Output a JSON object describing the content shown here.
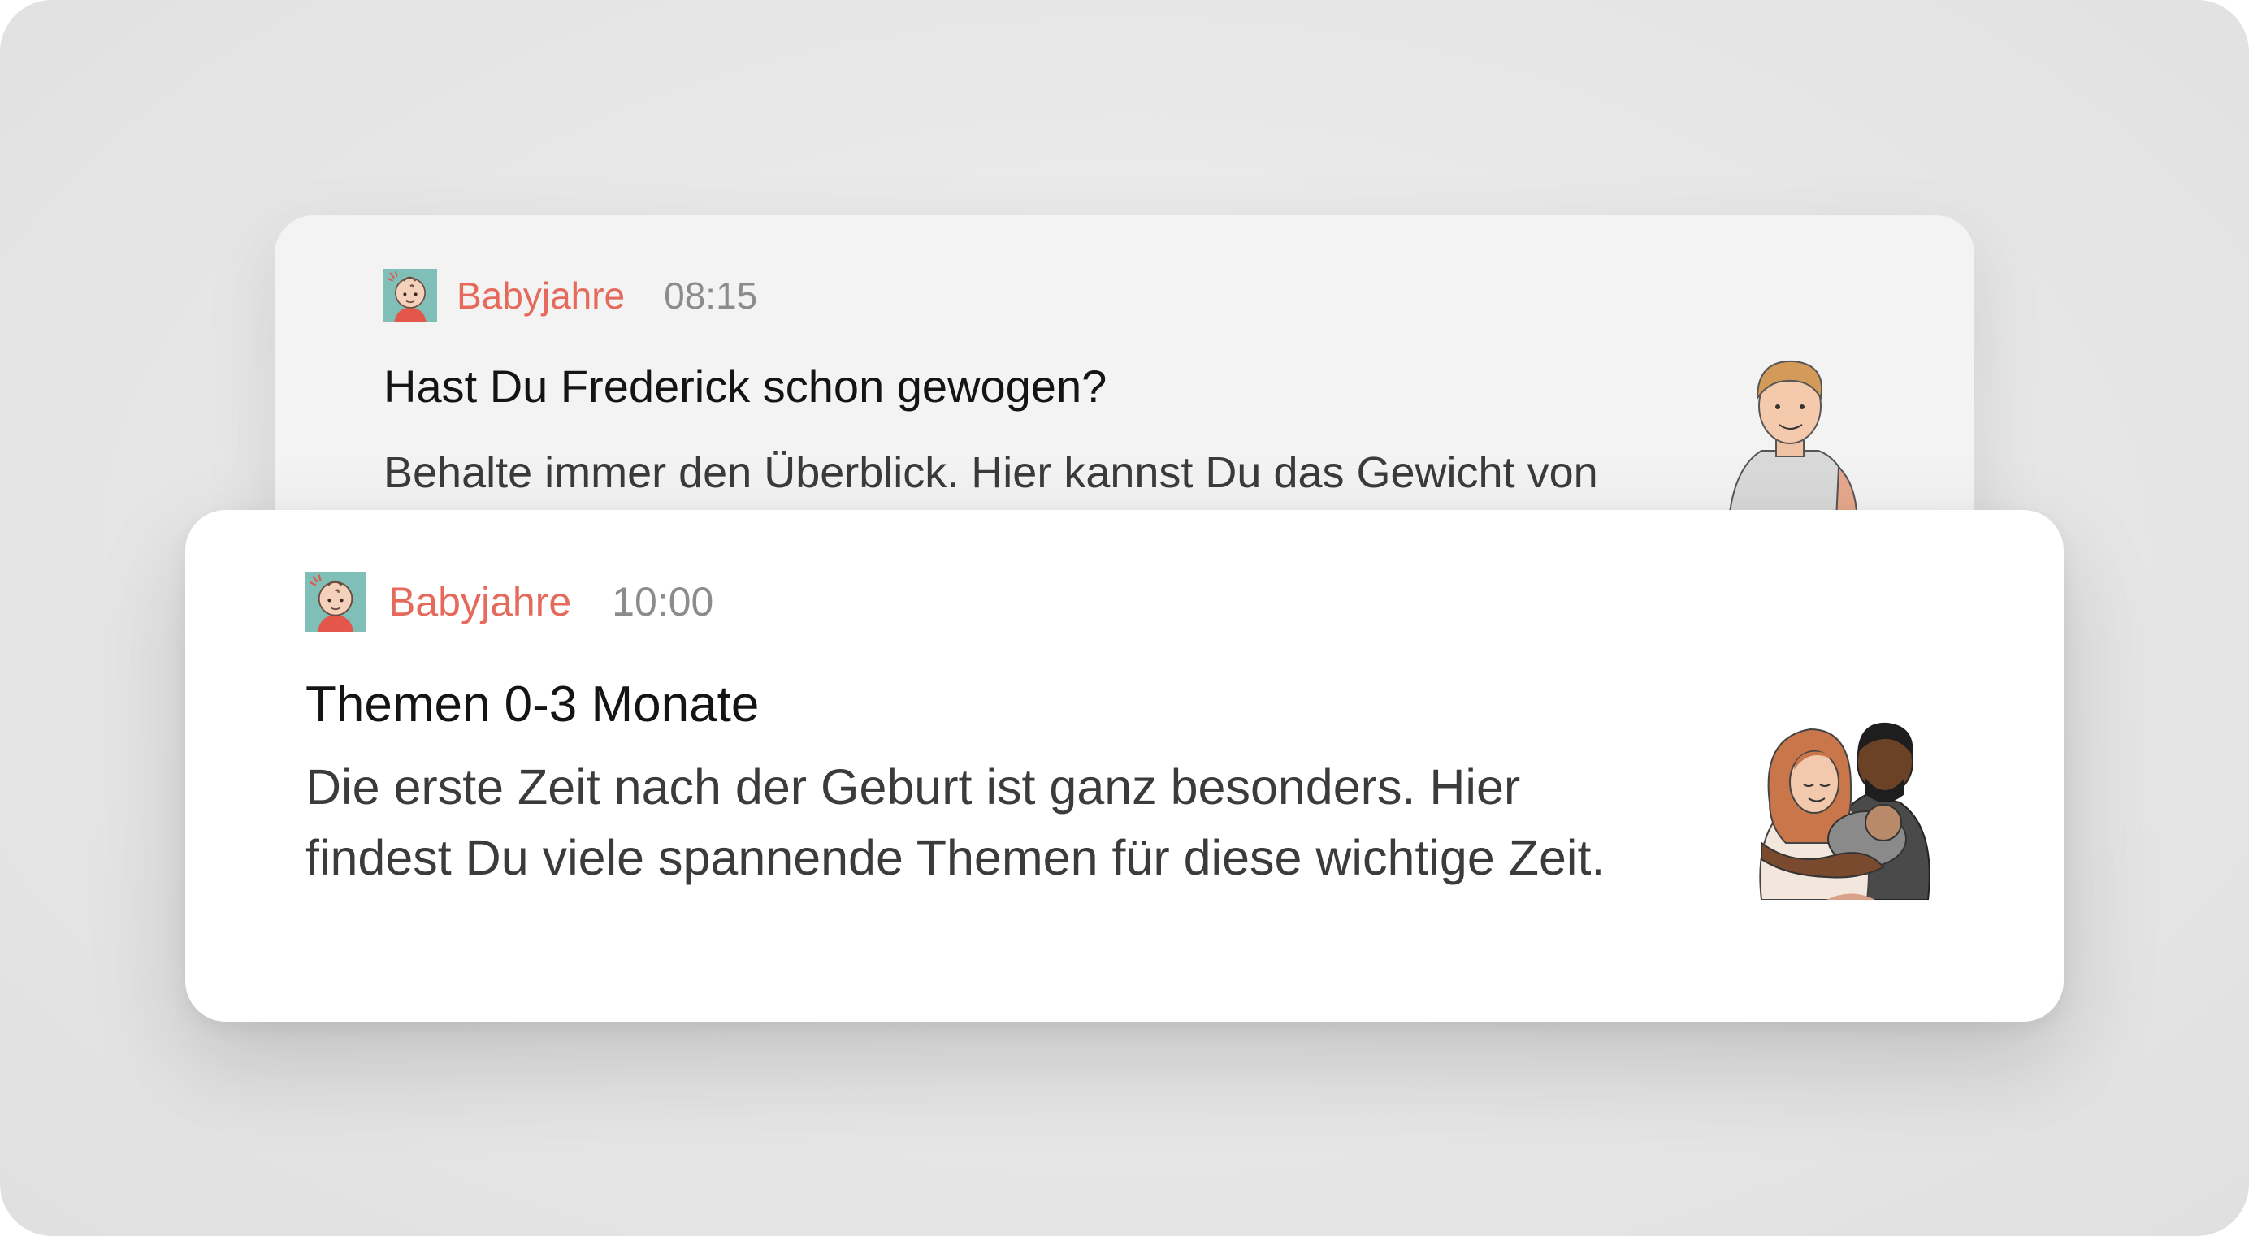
{
  "notifications": [
    {
      "app_name": "Babyjahre",
      "time": "08:15",
      "title": "Hast Du Frederick schon gewogen?",
      "body": "Behalte immer den Überblick. Hier kannst Du das Gewicht von Frederick eintragen.",
      "app_icon": "baby-face-icon",
      "illustration": "father-holding-baby-illustration"
    },
    {
      "app_name": "Babyjahre",
      "time": "10:00",
      "title": "Themen 0-3 Monate",
      "body": "Die erste Zeit nach der Geburt ist ganz besonders. Hier findest Du viele spannende Themen für diese wichtige Zeit.",
      "app_icon": "baby-face-icon",
      "illustration": "parents-holding-baby-illustration"
    }
  ],
  "colors": {
    "app_name": "#e56a5c",
    "time": "#8c8c8c",
    "icon_background": "#7fbfb8"
  }
}
